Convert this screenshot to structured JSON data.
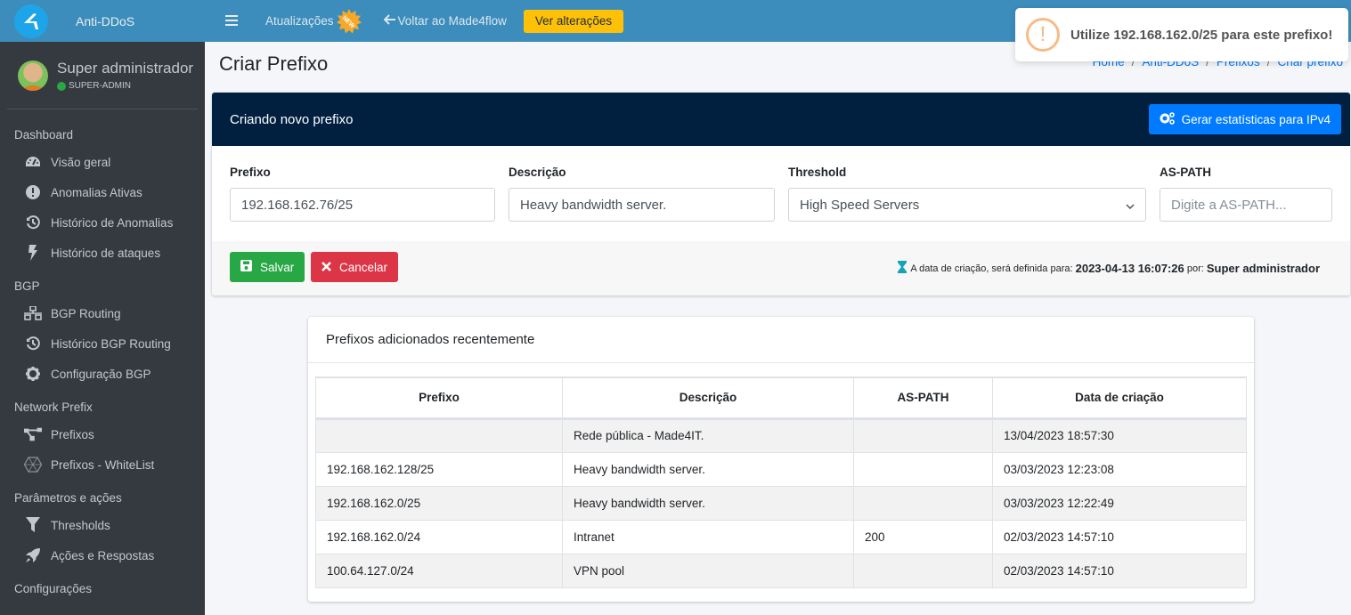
{
  "brand": {
    "name": "Anti-DDoS",
    "logo_icon": "brand-logo-icon"
  },
  "user": {
    "name": "Super administrador",
    "role": "SUPER-ADMIN",
    "status_color": "#28a745"
  },
  "sidebar": {
    "sections": [
      {
        "header": "Dashboard",
        "items": [
          {
            "label": "Visão geral",
            "icon": "tachometer-icon"
          },
          {
            "label": "Anomalias Ativas",
            "icon": "exclamation-circle-icon"
          },
          {
            "label": "Histórico de Anomalias",
            "icon": "history-icon"
          },
          {
            "label": "Histórico de ataques",
            "icon": "bolt-icon"
          }
        ]
      },
      {
        "header": "BGP",
        "items": [
          {
            "label": "BGP Routing",
            "icon": "network-wired-icon"
          },
          {
            "label": "Histórico BGP Routing",
            "icon": "history-icon"
          },
          {
            "label": "Configuração BGP",
            "icon": "cog-icon"
          }
        ]
      },
      {
        "header": "Network Prefix",
        "items": [
          {
            "label": "Prefixos",
            "icon": "project-diagram-icon"
          },
          {
            "label": "Prefixos - WhiteList",
            "icon": "hexagon-mesh-icon"
          }
        ]
      },
      {
        "header": "Parâmetros e ações",
        "items": [
          {
            "label": "Thresholds",
            "icon": "filter-icon"
          },
          {
            "label": "Ações e Respostas",
            "icon": "rocket-icon"
          }
        ]
      },
      {
        "header": "Configurações",
        "items": []
      }
    ]
  },
  "topbar": {
    "updates_label": "Atualizações",
    "new_badge": "NEW",
    "back_label": "Voltar ao Made4flow",
    "changes_button": "Ver alterações"
  },
  "page": {
    "title": "Criar Prefixo",
    "breadcrumb": [
      "Home",
      "Anti-DDoS",
      "Prefixos",
      "Criar prefixo"
    ]
  },
  "toast": {
    "message": "Utilize 192.168.162.0/25 para este prefixo!",
    "icon": "!"
  },
  "form": {
    "card_title": "Criando novo prefixo",
    "stats_button": "Gerar estatísticas para IPv4",
    "fields": {
      "prefix": {
        "label": "Prefixo",
        "value": "192.168.162.76/25"
      },
      "description": {
        "label": "Descrição",
        "value": "Heavy bandwidth server."
      },
      "threshold": {
        "label": "Threshold",
        "value": "High Speed Servers"
      },
      "as_path": {
        "label": "AS-PATH",
        "value": "",
        "placeholder": "Digite a AS-PATH..."
      }
    },
    "save_button": "Salvar",
    "cancel_button": "Cancelar",
    "created_text": "A data de criação, será definida para:",
    "created_date": "2023-04-13 16:07:26",
    "by_text": "por:",
    "created_by": "Super administrador"
  },
  "recent": {
    "title": "Prefixos adicionados recentemente",
    "columns": [
      "Prefixo",
      "Descrição",
      "AS-PATH",
      "Data de criação"
    ],
    "rows": [
      {
        "prefix": "",
        "description": "Rede pública - Made4IT.",
        "as_path": "",
        "created": "13/04/2023 18:57:30"
      },
      {
        "prefix": "192.168.162.128/25",
        "description": "Heavy bandwidth server.",
        "as_path": "",
        "created": "03/03/2023 12:23:08"
      },
      {
        "prefix": "192.168.162.0/25",
        "description": "Heavy bandwidth server.",
        "as_path": "",
        "created": "03/03/2023 12:22:49"
      },
      {
        "prefix": "192.168.162.0/24",
        "description": "Intranet",
        "as_path": "200",
        "created": "02/03/2023 14:57:10"
      },
      {
        "prefix": "100.64.127.0/24",
        "description": "VPN pool",
        "as_path": "",
        "created": "02/03/2023 14:57:10"
      }
    ]
  }
}
